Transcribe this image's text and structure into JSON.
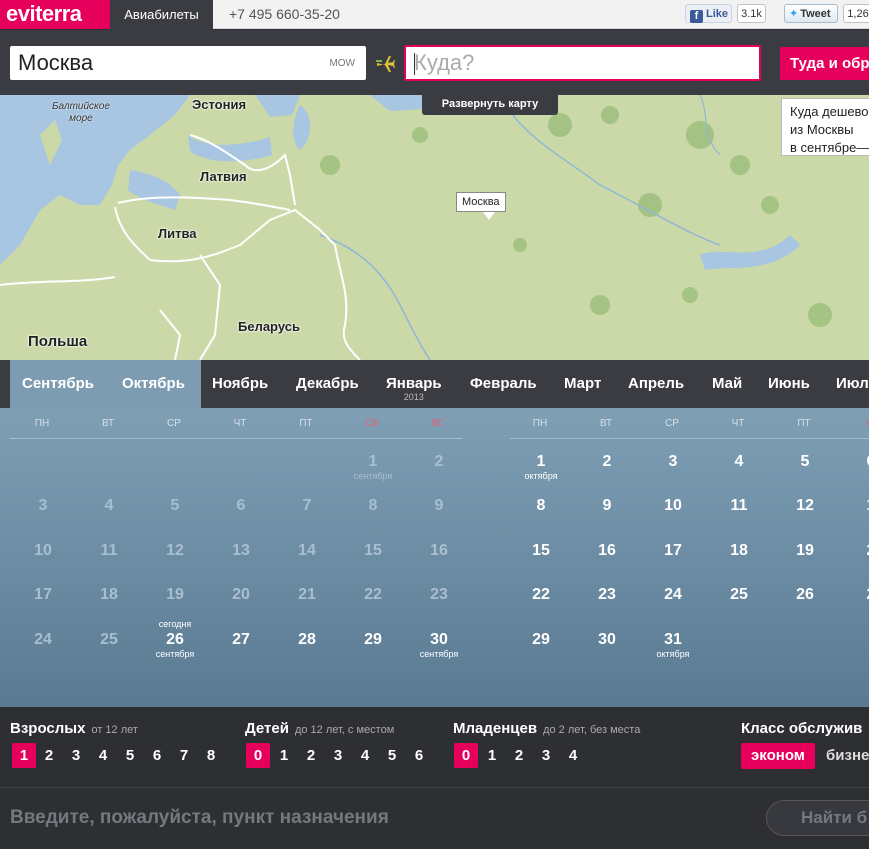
{
  "topbar": {
    "logo": "eviterra",
    "tab_air": "Авиабилеты",
    "phone": "+7 495 660-35-20",
    "like_label": "Like",
    "like_count": "3.1k",
    "tweet_label": "Tweet",
    "tweet_count": "1,26"
  },
  "search": {
    "from_value": "Москва",
    "from_code": "MOW",
    "to_placeholder": "Куда?",
    "roundtrip_label": "Туда и обр"
  },
  "map": {
    "expand_label": "Развернуть карту",
    "pin_label": "Москва",
    "cheap_tip": [
      "Куда дешево",
      "из Москвы",
      "в сентябре—"
    ],
    "labels": {
      "estonia": "Эстония",
      "latvia": "Латвия",
      "lithuania": "Литва",
      "belarus": "Беларусь",
      "poland": "Польша",
      "baltic_sea": [
        "Балтийское",
        "море"
      ]
    },
    "colors": {
      "land": "#c9d8a6",
      "sea": "#a4c4e2",
      "forest": "#9cbf7c"
    }
  },
  "months": {
    "items": [
      "Сентябрь",
      "Октябрь",
      "Ноябрь",
      "Декабрь",
      "Январь",
      "Февраль",
      "Март",
      "Апрель",
      "Май",
      "Июнь",
      "Июл"
    ],
    "january_year": "2013",
    "selected": [
      "Сентябрь",
      "Октябрь"
    ]
  },
  "calendar": {
    "weekdays": [
      "ПН",
      "ВТ",
      "СР",
      "ЧТ",
      "ПТ",
      "СБ",
      "ВС"
    ],
    "weekdays_right": [
      "ПН",
      "ВТ",
      "СР",
      "ЧТ",
      "ПТ",
      "С"
    ],
    "sept": {
      "row1": [
        "1",
        "2"
      ],
      "sub_first": "сентября",
      "row2": [
        "3",
        "4",
        "5",
        "6",
        "7",
        "8",
        "9"
      ],
      "row3": [
        "10",
        "11",
        "12",
        "13",
        "14",
        "15",
        "16"
      ],
      "row4": [
        "17",
        "18",
        "19",
        "20",
        "21",
        "22",
        "23"
      ],
      "row5": [
        "24",
        "25",
        "26",
        "27",
        "28",
        "29",
        "30"
      ],
      "today_top": "сегодня",
      "today_sub": "сентября",
      "last_sub": "сентября"
    },
    "oct": {
      "row1": [
        "1",
        "2",
        "3",
        "4",
        "5",
        "6"
      ],
      "sub_first": "октября",
      "row2": [
        "8",
        "9",
        "10",
        "11",
        "12",
        "1"
      ],
      "row3": [
        "15",
        "16",
        "17",
        "18",
        "19",
        "2"
      ],
      "row4": [
        "22",
        "23",
        "24",
        "25",
        "26",
        "2"
      ],
      "row5": [
        "29",
        "30",
        "31"
      ],
      "last_sub": "октября"
    },
    "colors": {
      "past_day": "#a8bfd0",
      "weekend": "#e06478"
    }
  },
  "passengers": {
    "adults_title": "Взрослых",
    "adults_note": "от 12 лет",
    "adults": [
      "1",
      "2",
      "3",
      "4",
      "5",
      "6",
      "7",
      "8"
    ],
    "children_title": "Детей",
    "children_note": "до 12 лет, с местом",
    "children": [
      "0",
      "1",
      "2",
      "3",
      "4",
      "5",
      "6"
    ],
    "infants_title": "Младенцев",
    "infants_note": "до 2 лет, без места",
    "infants": [
      "0",
      "1",
      "2",
      "3",
      "4"
    ],
    "class_title": "Класс обслужив",
    "class_economy": "эконом",
    "class_business": "бизне"
  },
  "bottom": {
    "prompt": "Введите, пожалуйста, пункт назначения",
    "find_label": "Найти б"
  },
  "accent": "#e6005c"
}
